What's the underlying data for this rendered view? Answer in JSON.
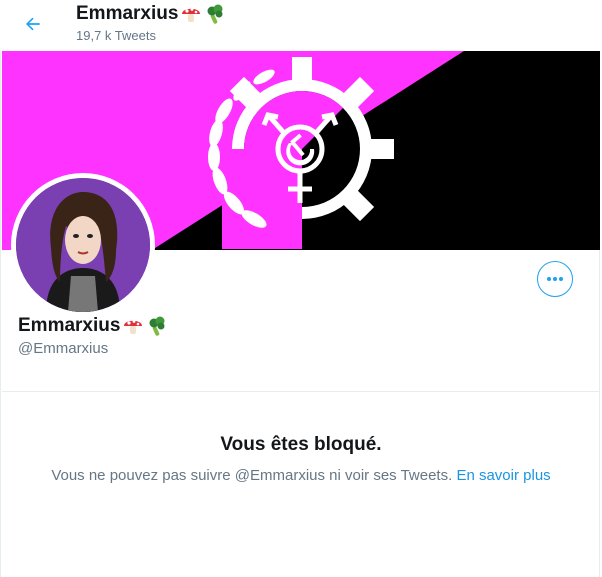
{
  "header": {
    "back_icon": "arrow-left-icon",
    "name": "Emmarxius",
    "tweet_count": "19,7 k Tweets"
  },
  "banner": {
    "colors": {
      "pink": "#ff33ff",
      "black": "#000000",
      "white": "#ffffff"
    },
    "icon": "trans-socialist-gear-emblem"
  },
  "profile": {
    "name": "Emmarxius",
    "handle": "@Emmarxius",
    "emojis": [
      "mushroom-emoji",
      "broccoli-emoji"
    ],
    "avatar_background": "#7a3fb0"
  },
  "more_button": {
    "icon": "more-horizontal-icon",
    "color": "#1da1f2"
  },
  "blocked": {
    "title": "Vous êtes bloqué.",
    "description": "Vous ne pouvez pas suivre @Emmarxius ni voir ses Tweets.",
    "link": "En savoir plus"
  }
}
